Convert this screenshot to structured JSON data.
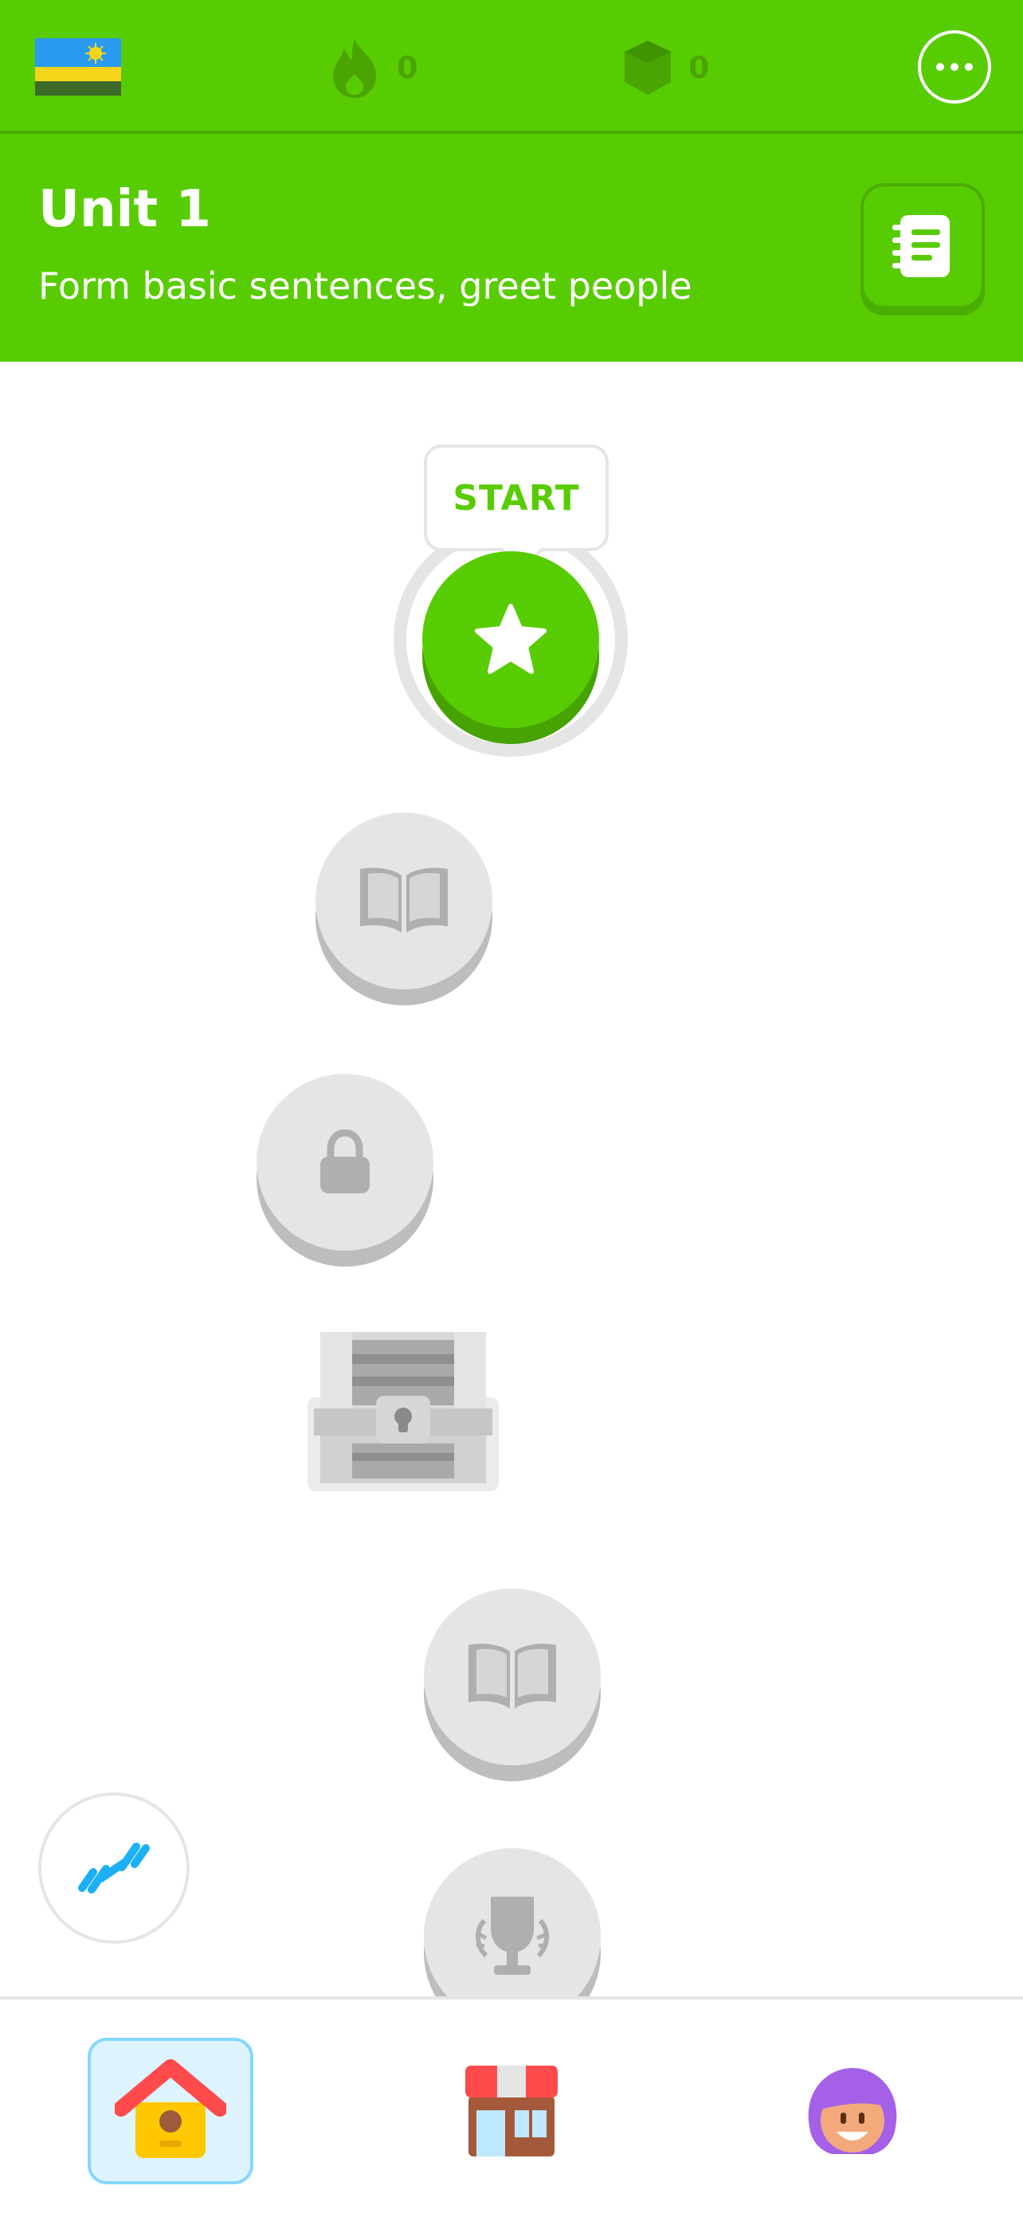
{
  "header": {
    "flag_icon": "rwanda-flag-icon",
    "streak": {
      "icon": "flame-icon",
      "count": "0"
    },
    "gems": {
      "icon": "gem-icon",
      "count": "0"
    },
    "more_icon": "more-horizontal-icon"
  },
  "unit": {
    "title": "Unit 1",
    "subtitle": "Form basic sentences, greet people",
    "guide_icon": "notebook-icon"
  },
  "path": {
    "start_label": "START",
    "nodes": [
      {
        "type": "lesson",
        "state": "active",
        "icon": "star-icon"
      },
      {
        "type": "story",
        "state": "locked",
        "icon": "book-icon"
      },
      {
        "type": "lesson",
        "state": "locked",
        "icon": "lock-icon"
      },
      {
        "type": "chest",
        "state": "locked",
        "icon": "treasure-chest-icon"
      },
      {
        "type": "story",
        "state": "locked",
        "icon": "book-icon"
      },
      {
        "type": "trophy",
        "state": "locked",
        "icon": "trophy-icon"
      }
    ]
  },
  "practice": {
    "icon": "dumbbell-icon"
  },
  "bottom_nav": {
    "items": [
      {
        "name": "home",
        "icon": "home-icon",
        "active": true
      },
      {
        "name": "shop",
        "icon": "shop-icon",
        "active": false
      },
      {
        "name": "profile",
        "icon": "profile-avatar-icon",
        "active": false
      }
    ]
  },
  "colors": {
    "brand_green": "#58cc02",
    "locked_grey": "#e5e5e5",
    "nav_active_bg": "#ddf4ff",
    "practice_blue": "#1cb0f6"
  }
}
